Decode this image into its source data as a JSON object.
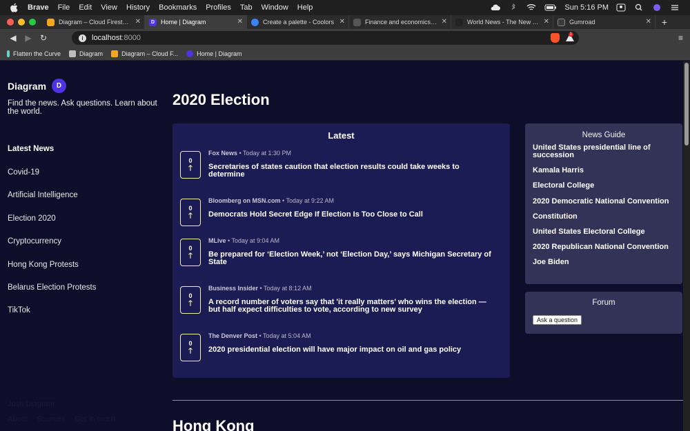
{
  "menubar": {
    "app": "Brave",
    "items": [
      "File",
      "Edit",
      "View",
      "History",
      "Bookmarks",
      "Profiles",
      "Tab",
      "Window",
      "Help"
    ],
    "clock": "Sun 5:16 PM"
  },
  "tabs": [
    {
      "title": "Diagram – Cloud Firestore – ",
      "favicon": "firebase-icon",
      "color": "#f5a623",
      "active": false
    },
    {
      "title": "Home | Diagram",
      "favicon": "diagram-d-icon",
      "color": "#4f33e0",
      "active": true
    },
    {
      "title": "Create a palette - Coolors",
      "favicon": "coolors-icon",
      "color": "#3b82f6",
      "active": false
    },
    {
      "title": "Finance and economics — Q",
      "favicon": "qz-icon",
      "color": "#555555",
      "active": false
    },
    {
      "title": "World News - The New York ",
      "favicon": "nyt-icon",
      "color": "#222222",
      "active": false
    },
    {
      "title": "Gumroad",
      "favicon": "gumroad-icon",
      "color": "#3a3a3a",
      "active": false
    }
  ],
  "toolbar": {
    "url_host": "localhost",
    "url_port": ":8000",
    "rewards_badge": "1"
  },
  "bookmarks": [
    {
      "label": "Flatten the Curve",
      "icon": "curve-icon",
      "color": "#6ad0c0"
    },
    {
      "label": "Diagram",
      "icon": "folder-icon",
      "color": "#bdbdbd"
    },
    {
      "label": "Diagram – Cloud F...",
      "icon": "firebase-icon",
      "color": "#f5a623"
    },
    {
      "label": "Home | Diagram",
      "icon": "diagram-d-icon",
      "color": "#4f33e0"
    }
  ],
  "sidebar": {
    "brand": "Diagram",
    "logo_letter": "D",
    "tagline": "Find the news. Ask questions. Learn about the world.",
    "heading": "Latest News",
    "items": [
      "Covid-19",
      "Artificial Intelligence",
      "Election 2020",
      "Cryptocurrency",
      "Hong Kong Protests",
      "Belarus Election Protests",
      "TikTok"
    ],
    "footer_name": "Josh Diagram",
    "footer_links": [
      "About",
      "Sources",
      "Get in touch"
    ]
  },
  "main": {
    "section_title": "2020 Election",
    "latest_heading": "Latest",
    "articles": [
      {
        "source": "Fox News",
        "time": "Today at 1:30 PM",
        "votes": "0",
        "title": "Secretaries of states caution that election results could take weeks to determine"
      },
      {
        "source": "Bloomberg on MSN.com",
        "time": "Today at 9:22 AM",
        "votes": "0",
        "title": "Democrats Hold Secret Edge If Election Is Too Close to Call"
      },
      {
        "source": "MLive",
        "time": "Today at 9:04 AM",
        "votes": "0",
        "title": "Be prepared for ‘Election Week,’ not ‘Election Day,’ says Michigan Secretary of State"
      },
      {
        "source": "Business Insider",
        "time": "Today at 8:12 AM",
        "votes": "0",
        "title": "A record number of voters say that 'it really matters' who wins the election — but half expect difficulties to vote, according to new survey"
      },
      {
        "source": "The Denver Post",
        "time": "Today at 5:04 AM",
        "votes": "0",
        "title": "2020 presidential election will have major impact on oil and gas policy"
      }
    ],
    "guide_heading": "News Guide",
    "guide_items": [
      "United States presidential line of succession",
      "Kamala Harris",
      "Electoral College",
      "2020 Democratic National Convention",
      "Constitution",
      "United States Electoral College",
      "2020 Republican National Convention",
      "Joe Biden"
    ],
    "forum_heading": "Forum",
    "ask_label": "Ask a question",
    "next_section_title": "Hong Kong"
  }
}
